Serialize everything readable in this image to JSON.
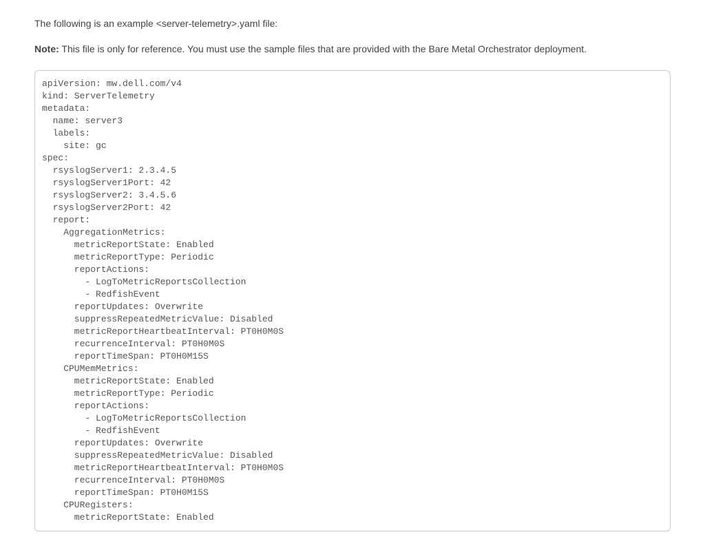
{
  "intro": "The following is an example <server-telemetry>.yaml file:",
  "note": {
    "label": "Note:",
    "text": " This file is only for reference. You must use the sample files that are provided with the Bare Metal Orchestrator deployment."
  },
  "code": "apiVersion: mw.dell.com/v4\nkind: ServerTelemetry\nmetadata:\n  name: server3\n  labels:\n    site: gc\nspec:\n  rsyslogServer1: 2.3.4.5\n  rsyslogServer1Port: 42\n  rsyslogServer2: 3.4.5.6\n  rsyslogServer2Port: 42\n  report:\n    AggregationMetrics:\n      metricReportState: Enabled\n      metricReportType: Periodic\n      reportActions:\n        - LogToMetricReportsCollection\n        - RedfishEvent\n      reportUpdates: Overwrite\n      suppressRepeatedMetricValue: Disabled\n      metricReportHeartbeatInterval: PT0H0M0S\n      recurrenceInterval: PT0H0M0S\n      reportTimeSpan: PT0H0M15S\n    CPUMemMetrics:\n      metricReportState: Enabled\n      metricReportType: Periodic\n      reportActions:\n        - LogToMetricReportsCollection\n        - RedfishEvent\n      reportUpdates: Overwrite\n      suppressRepeatedMetricValue: Disabled\n      metricReportHeartbeatInterval: PT0H0M0S\n      recurrenceInterval: PT0H0M0S\n      reportTimeSpan: PT0H0M15S\n    CPURegisters:\n      metricReportState: Enabled"
}
